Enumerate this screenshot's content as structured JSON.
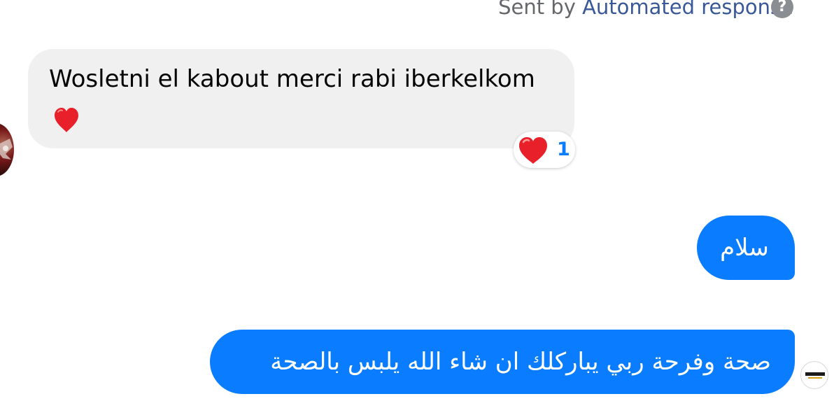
{
  "header": {
    "sent_by_prefix": "Sent by ",
    "sent_by_link": "Automated response",
    "help_icon_glyph": "?"
  },
  "incoming_message": {
    "text": "Wosletni el kabout merci rabi iberkelkom",
    "emoji": "red-heart",
    "reaction": {
      "emoji": "red-heart",
      "count": "1"
    }
  },
  "outgoing_messages": [
    {
      "text": "سلام"
    },
    {
      "text": "صحة وفرحة ربي يباركلك  ان شاء الله  يلبس بالصحة"
    }
  ],
  "colors": {
    "outgoing_bubble": "#0a7cff",
    "incoming_bubble": "#f0f0f0",
    "link": "#385898",
    "meta_text": "#65676b",
    "heart": "#e8202a"
  },
  "icons": {
    "help": "question-circle-icon",
    "heart": "heart-icon",
    "avatar_left": "contact-avatar",
    "avatar_right": "page-avatar"
  }
}
